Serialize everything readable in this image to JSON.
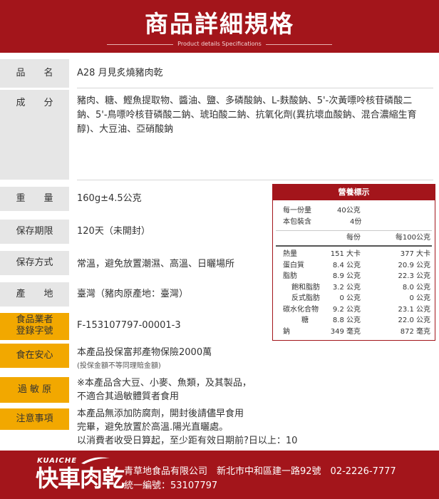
{
  "header": {
    "title": "商品詳細規格",
    "subtitle": "Product details Specifications"
  },
  "specs": {
    "name_label": "品　　名",
    "name_value": "A28 月見炙燒豬肉乾",
    "ingredients_label": "成　　分",
    "ingredients_value": "豬肉、糖、鰹魚提取物、醬油、鹽、多磷酸鈉、L-麩酸鈉、5'-次黃嘌呤核苷磷酸二鈉、5'-鳥嘌呤核苷磷酸二鈉、琥珀酸二鈉、抗氧化劑(異抗壞血酸鈉、混合濃縮生育醇)、大豆油、亞硝酸鈉",
    "weight_label": "重　　量",
    "weight_value": "160g±4.5公克",
    "shelf_label": "保存期限",
    "shelf_value": "120天（未開封）",
    "storage_label": "保存方式",
    "storage_value": "常溫，避免放置潮濕、高溫、日曬場所",
    "origin_label": "產　　地",
    "origin_value": "臺灣（豬肉原產地：臺灣）",
    "license_label_1": "食品業者",
    "license_label_2": "登錄字號",
    "license_value": "F-153107797-00001-3",
    "insurance_label": "食在安心",
    "insurance_value": "本產品投保富邦產物保險2000萬",
    "insurance_note": "(投保金額不等同理賠金額)",
    "allergen_label": "過 敏 原",
    "allergen_line1": "※本產品含大豆、小麥、魚類，及其製品，",
    "allergen_line2": "不適合其過敏體質者食用",
    "notes_label": "注意事項",
    "notes_line1": "本產品無添加防腐劑，開封後請儘早食用",
    "notes_line2": "完畢，避免放置於高溫.陽光直曬處。",
    "notes_line3": "以消費者收受日算起，至少距有效日期前?日以上：10"
  },
  "nutrition": {
    "title": "營養標示",
    "serving_label": "每一份量",
    "serving_value": "40公克",
    "servings_label": "本包裝含",
    "servings_value": "4份",
    "col_per_serving": "每份",
    "col_per_100": "每100公克",
    "rows": [
      {
        "name": "熱量",
        "serv": "151 大卡",
        "per100": "377 大卡"
      },
      {
        "name": "蛋白質",
        "serv": "8.4 公克",
        "per100": "20.9 公克"
      },
      {
        "name": "脂肪",
        "serv": "8.9 公克",
        "per100": "22.3 公克"
      },
      {
        "name": "飽和脂肪",
        "serv": "3.2 公克",
        "per100": "8.0 公克"
      },
      {
        "name": "反式脂肪",
        "serv": "0 公克",
        "per100": "0 公克"
      },
      {
        "name": "碳水化合物",
        "serv": "9.2 公克",
        "per100": "23.1 公克"
      },
      {
        "name": "糖",
        "serv": "8.8 公克",
        "per100": "22.0 公克"
      },
      {
        "name": "鈉",
        "serv": "349 毫克",
        "per100": "872 毫克"
      }
    ]
  },
  "footer": {
    "logo_en": "KUAICHE",
    "logo_zh": "快車肉乾",
    "company_line": "青草地食品有限公司　新北市中和區建一路92號　02-2226-7777",
    "tax_line": "統一編號：53107797"
  }
}
